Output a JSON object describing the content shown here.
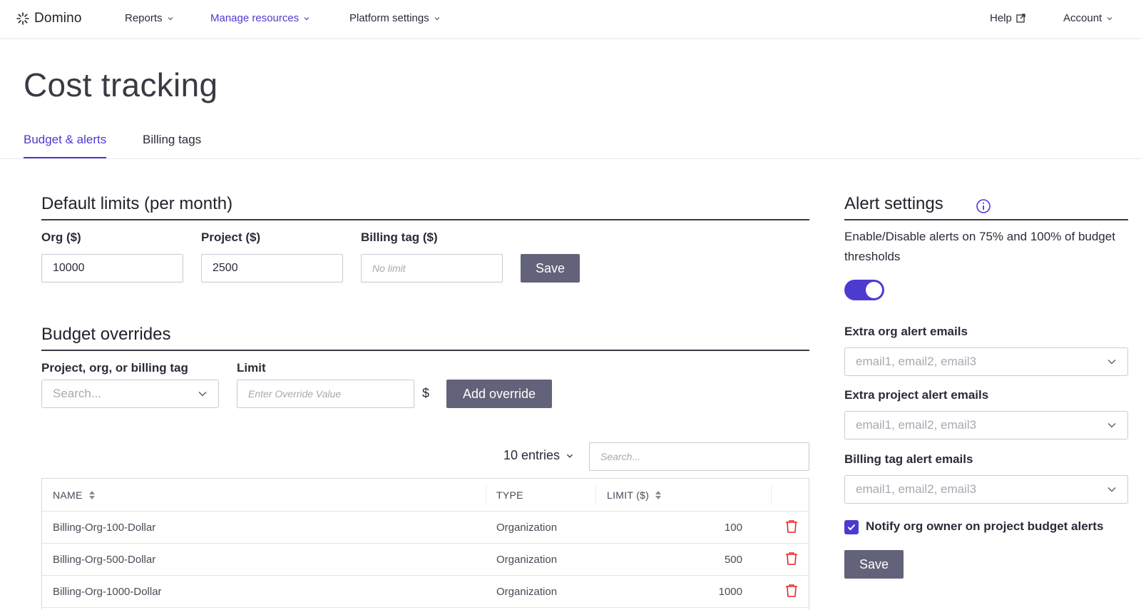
{
  "nav": {
    "logo": "Domino",
    "reports": "Reports",
    "manage_resources": "Manage resources",
    "platform_settings": "Platform settings",
    "help": "Help",
    "account": "Account"
  },
  "page_title": "Cost tracking",
  "tabs": [
    {
      "label": "Budget & alerts",
      "active": true
    },
    {
      "label": "Billing tags",
      "active": false
    }
  ],
  "default_limits": {
    "title": "Default limits (per month)",
    "org_label": "Org ($)",
    "org_value": "10000",
    "project_label": "Project ($)",
    "project_value": "2500",
    "billing_label": "Billing tag ($)",
    "billing_placeholder": "No limit",
    "save_label": "Save"
  },
  "budget_overrides": {
    "title": "Budget overrides",
    "target_label": "Project, org, or billing tag",
    "target_placeholder": "Search...",
    "limit_label": "Limit",
    "limit_placeholder": "Enter Override Value",
    "currency": "$",
    "add_label": "Add override"
  },
  "table": {
    "entries_label": "10 entries",
    "search_placeholder": "Search...",
    "headers": {
      "name": "NAME",
      "type": "TYPE",
      "limit": "LIMIT ($)"
    },
    "rows": [
      {
        "name": "Billing-Org-100-Dollar",
        "type": "Organization",
        "limit": "100"
      },
      {
        "name": "Billing-Org-500-Dollar",
        "type": "Organization",
        "limit": "500"
      },
      {
        "name": "Billing-Org-1000-Dollar",
        "type": "Organization",
        "limit": "1000"
      }
    ]
  },
  "alert_settings": {
    "title": "Alert settings",
    "description": "Enable/Disable alerts on 75% and 100% of budget thresholds",
    "alerts_enabled": true,
    "org_emails_label": "Extra org alert emails",
    "project_emails_label": "Extra project alert emails",
    "billing_emails_label": "Billing tag alert emails",
    "emails_placeholder": "email1, email2, email3",
    "notify_label": "Notify org owner on project budget alerts",
    "notify_checked": true,
    "save_label": "Save"
  },
  "colors": {
    "accent": "#4c3bcf",
    "button": "#62627a",
    "danger": "#e5252a"
  }
}
